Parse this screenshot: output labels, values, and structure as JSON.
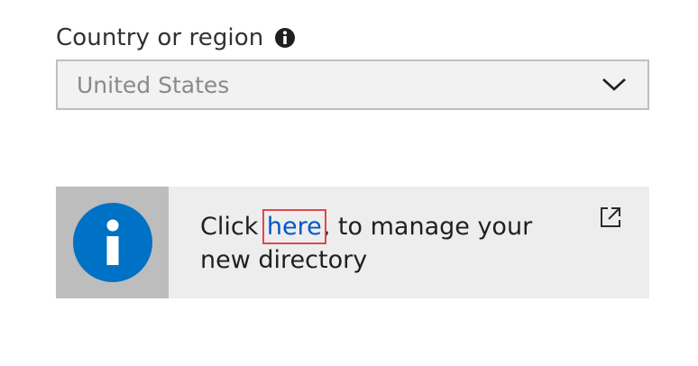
{
  "country_field": {
    "label": "Country or region",
    "selected_value": "United States",
    "info_icon": "info-circle-icon",
    "dropdown_icon": "chevron-down-icon"
  },
  "info_banner": {
    "icon": "info-icon",
    "text_prefix": "Click ",
    "link_text": "here",
    "text_suffix": ", to manage your new directory",
    "external_icon": "external-link-icon",
    "accent_color": "#0072c6",
    "link_color": "#0058c4",
    "highlight_color": "#e0474c"
  }
}
